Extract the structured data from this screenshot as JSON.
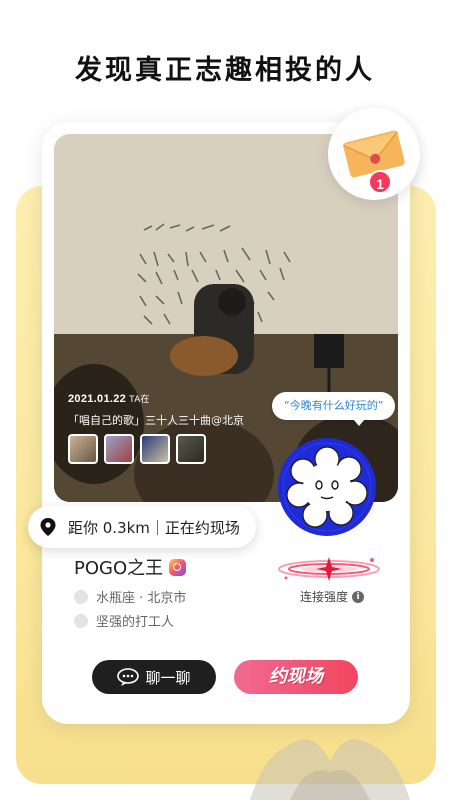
{
  "headline": "发现真正志趣相投的人",
  "notification": {
    "icon": "envelope-icon",
    "count": "1"
  },
  "post": {
    "date": "2021.01.22",
    "date_suffix": "TA在",
    "caption": "「唱自己的歌」三十人三十曲@北京"
  },
  "speech_bubble": "“今晚有什么好玩的”",
  "distance": {
    "text": "距你  0.3km｜正在约现场"
  },
  "profile": {
    "username": "POGO之王",
    "zodiac_location": "水瓶座 · 北京市",
    "occupation": "坚强的打工人"
  },
  "connection": {
    "label": "连接强度",
    "info_glyph": "i"
  },
  "actions": {
    "chat_label": "聊一聊",
    "meet_label": "约现场"
  },
  "colors": {
    "accent_pink": "#f2455e",
    "avatar_blue": "#1f2ad8",
    "backdrop_yellow": "#fbe89e",
    "speech_blue": "#2a86d6"
  }
}
